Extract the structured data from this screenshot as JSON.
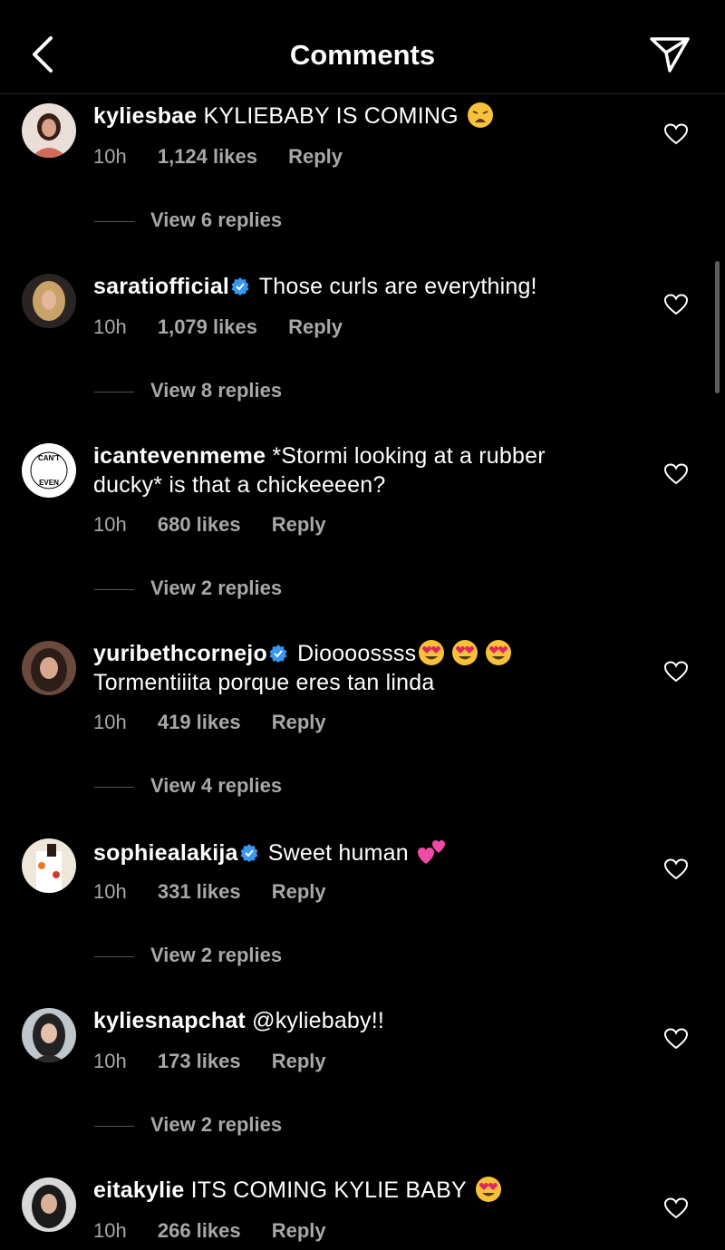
{
  "header": {
    "title": "Comments"
  },
  "comments": [
    {
      "username": "kyliesbae",
      "verified": false,
      "text": "KYLIEBABY IS COMING",
      "emoji": "weary-face",
      "time": "10h",
      "likes": "1,124 likes",
      "reply": "Reply",
      "view_replies": "View 6 replies"
    },
    {
      "username": "saratiofficial",
      "verified": true,
      "text": "Those curls are everything!",
      "time": "10h",
      "likes": "1,079 likes",
      "reply": "Reply",
      "view_replies": "View 8 replies"
    },
    {
      "username": "icantevenmeme",
      "verified": false,
      "text": "*Stormi looking at a rubber",
      "text2": "ducky* is that a chickeeeen?",
      "time": "10h",
      "likes": "680 likes",
      "reply": "Reply",
      "view_replies": "View 2 replies"
    },
    {
      "username": "yuribethcornejo",
      "verified": true,
      "text": "Dioooossss",
      "emoji": "heart-eyes-x3",
      "text2": "Tormentiiita porque eres tan linda",
      "time": "10h",
      "likes": "419 likes",
      "reply": "Reply",
      "view_replies": "View 4 replies"
    },
    {
      "username": "sophiealakija",
      "verified": true,
      "text": "Sweet human",
      "emoji": "two-hearts",
      "time": "10h",
      "likes": "331 likes",
      "reply": "Reply",
      "view_replies": "View 2 replies"
    },
    {
      "username": "kyliesnapchat",
      "verified": false,
      "text": "@kyliebaby!!",
      "time": "10h",
      "likes": "173 likes",
      "reply": "Reply",
      "view_replies": "View 2 replies"
    },
    {
      "username": "eitakylie",
      "verified": false,
      "text": "ITS COMING KYLIE BABY",
      "emoji": "heart-eyes",
      "time": "10h",
      "likes": "266 likes",
      "reply": "Reply"
    }
  ],
  "icons": {
    "back": "chevron-left-icon",
    "send": "paper-plane-icon",
    "like": "heart-outline-icon",
    "verified": "verified-badge-icon"
  },
  "colors": {
    "background": "#000000",
    "text": "#ffffff",
    "secondary": "#a8a8a8",
    "verified": "#3897f0"
  }
}
